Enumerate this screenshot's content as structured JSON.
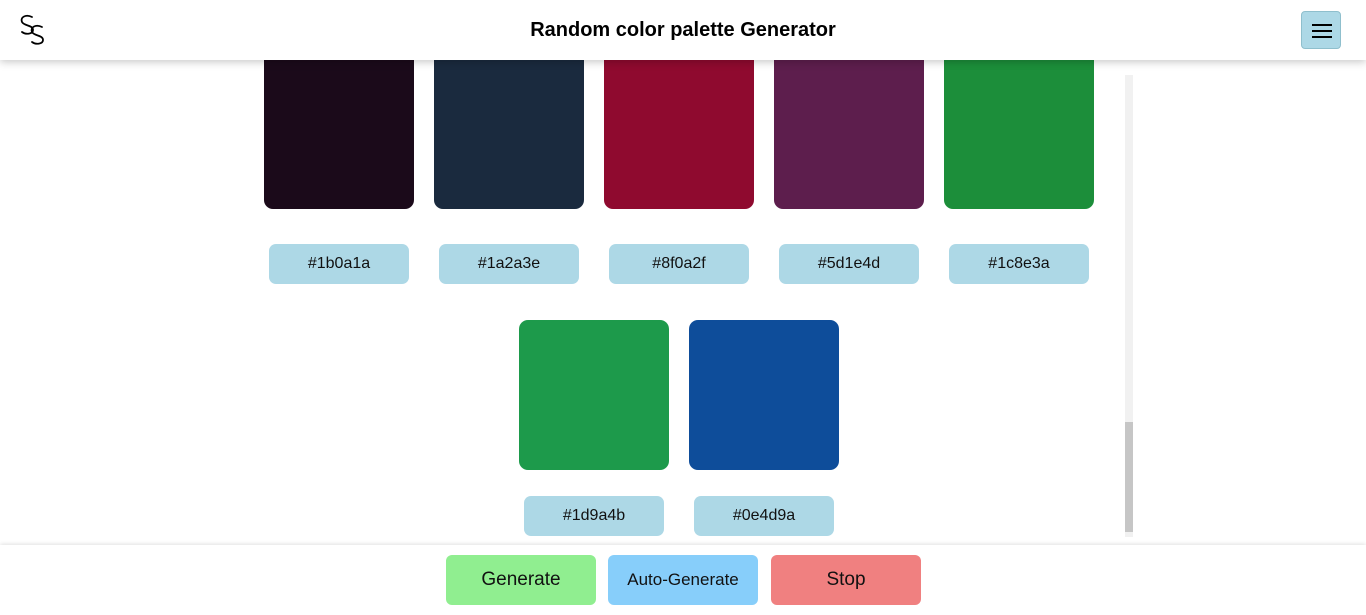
{
  "header": {
    "logo_text": "SS",
    "title": "Random color palette Generator",
    "menu_icon": "hamburger-menu-icon"
  },
  "palette": {
    "row1": [
      {
        "hex": "#1b0a1a",
        "color": "#1b0a1a"
      },
      {
        "hex": "#1a2a3e",
        "color": "#1a2a3e"
      },
      {
        "hex": "#8f0a2f",
        "color": "#8f0a2f"
      },
      {
        "hex": "#5d1e4d",
        "color": "#5d1e4d"
      },
      {
        "hex": "#1c8e3a",
        "color": "#1c8e3a"
      }
    ],
    "row2": [
      {
        "hex": "#1d9a4b",
        "color": "#1d9a4b"
      },
      {
        "hex": "#0e4d9a",
        "color": "#0e4d9a"
      }
    ]
  },
  "footer": {
    "generate_label": "Generate",
    "auto_generate_label": "Auto-Generate",
    "stop_label": "Stop",
    "generate_color": "#90ee90",
    "auto_generate_color": "#87cefa",
    "stop_color": "#f08080"
  },
  "colors": {
    "label_bg": "#add8e6"
  }
}
